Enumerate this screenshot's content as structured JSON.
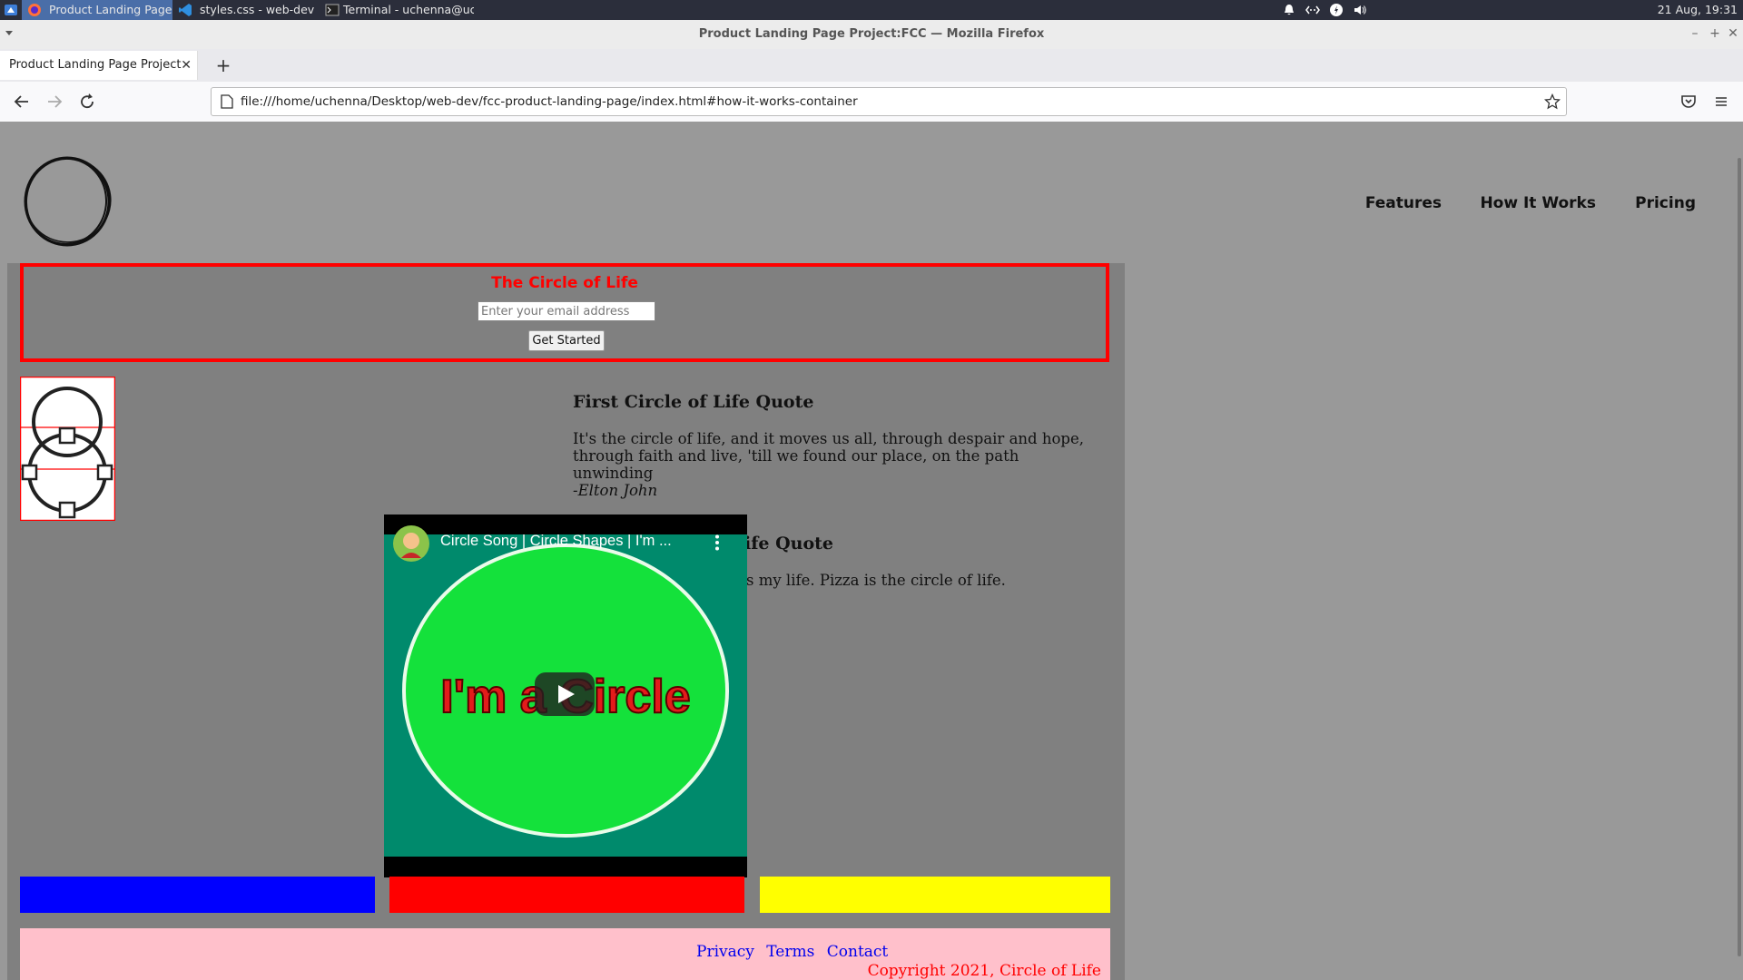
{
  "taskbar": {
    "tasks": [
      {
        "label": "Product Landing Page Proje...",
        "active": true
      },
      {
        "label": "styles.css - web-dev - Visual ...",
        "active": false
      },
      {
        "label": "Terminal - uchenna@uchen...",
        "active": false
      }
    ],
    "clock": "21 Aug, 19:31"
  },
  "window": {
    "title": "Product Landing Page Project:FCC — Mozilla Firefox"
  },
  "browser": {
    "tab_title": "Product Landing Page Project:FCC",
    "url": "file:///home/uchenna/Desktop/web-dev/fcc-product-landing-page/index.html#how-it-works-container"
  },
  "page": {
    "nav": [
      "Features",
      "How It Works",
      "Pricing"
    ],
    "hero": {
      "title": "The Circle of Life",
      "email_placeholder": "Enter your email address",
      "button": "Get Started"
    },
    "quotes": [
      {
        "heading": "First Circle of Life Quote",
        "text": "It's the circle of life, and it moves us all, through despair and hope, through faith and live, 'till we found our place, on the path unwinding",
        "author": "-Elton John"
      },
      {
        "heading_visible": "ife Quote",
        "text_visible": "s my life. Pizza is the circle of life."
      }
    ],
    "video": {
      "title": "Circle Song | Circle Shapes | I'm ...",
      "thumbnail_text": "I'm a Circle"
    },
    "bars": [
      {
        "color": "#0000ff"
      },
      {
        "color": "#ff0000"
      },
      {
        "color": "#ffff00"
      }
    ],
    "footer": {
      "links": [
        "Privacy",
        "Terms",
        "Contact"
      ],
      "copyright": "Copyright 2021, Circle of Life"
    }
  }
}
